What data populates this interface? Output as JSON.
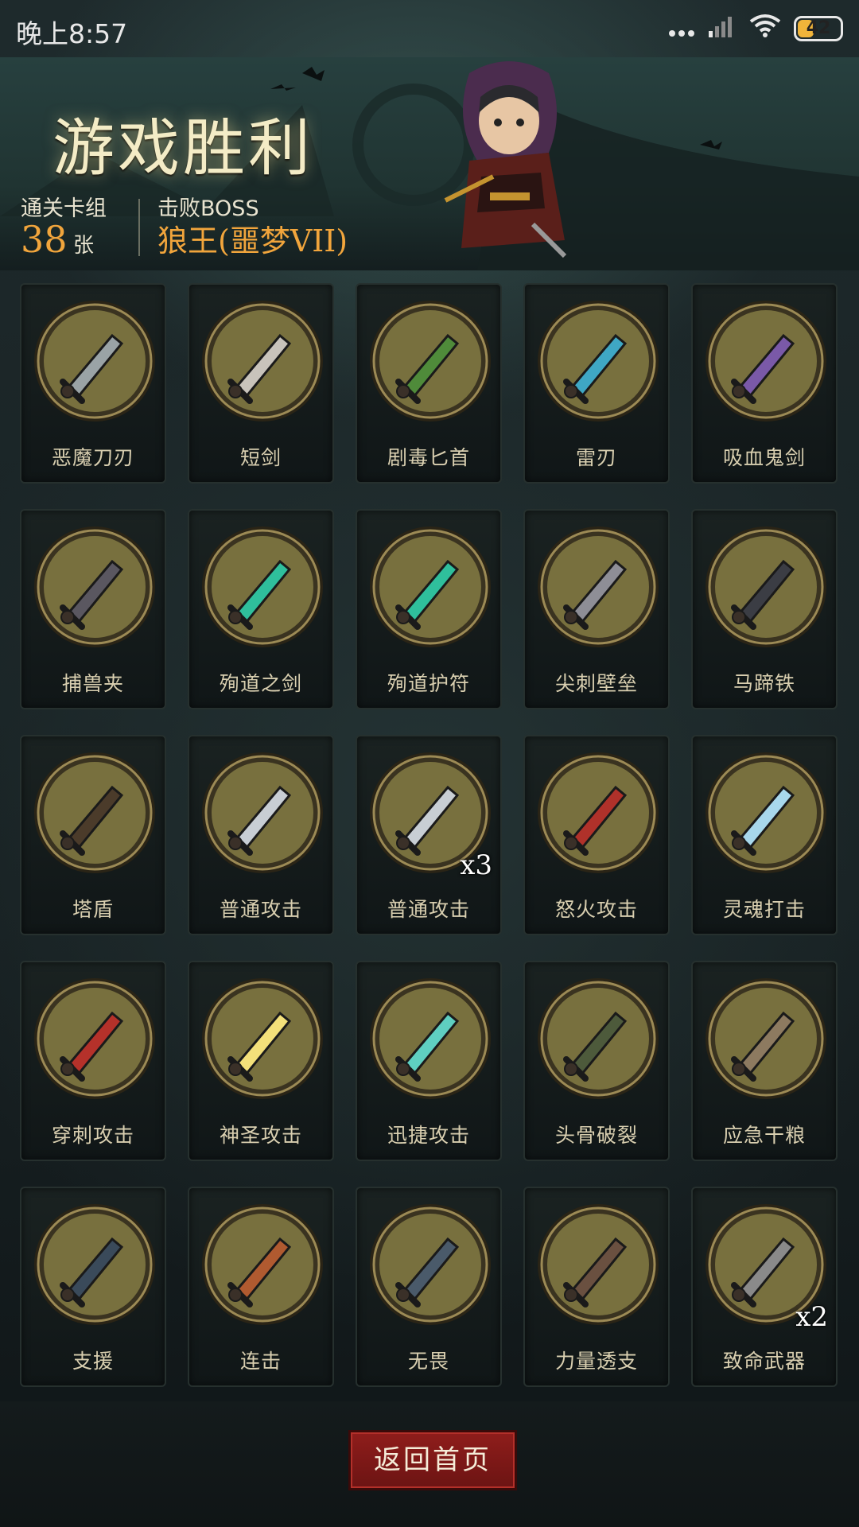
{
  "status": {
    "time": "晚上8:57",
    "battery": "42",
    "battery_level": 0.42
  },
  "header": {
    "title": "游戏胜利",
    "deck_label": "通关卡组",
    "deck_count": "38",
    "deck_unit": "张",
    "boss_label": "击败BOSS",
    "boss_name": "狼王(噩梦VII)"
  },
  "cards": [
    {
      "name": "恶魔刀刃",
      "icon": "demon-blade-icon",
      "count": ""
    },
    {
      "name": "短剑",
      "icon": "short-sword-icon",
      "count": ""
    },
    {
      "name": "剧毒匕首",
      "icon": "poison-dagger-icon",
      "count": ""
    },
    {
      "name": "雷刃",
      "icon": "thunder-blade-icon",
      "count": ""
    },
    {
      "name": "吸血鬼剑",
      "icon": "vampire-sword-icon",
      "count": ""
    },
    {
      "name": "捕兽夹",
      "icon": "bear-trap-icon",
      "count": ""
    },
    {
      "name": "殉道之剑",
      "icon": "martyr-sword-icon",
      "count": ""
    },
    {
      "name": "殉道护符",
      "icon": "martyr-amulet-icon",
      "count": ""
    },
    {
      "name": "尖刺壁垒",
      "icon": "spike-wall-icon",
      "count": ""
    },
    {
      "name": "马蹄铁",
      "icon": "horseshoe-icon",
      "count": ""
    },
    {
      "name": "塔盾",
      "icon": "tower-shield-icon",
      "count": ""
    },
    {
      "name": "普通攻击",
      "icon": "basic-attack-icon",
      "count": ""
    },
    {
      "name": "普通攻击",
      "icon": "basic-attack-icon",
      "count": "x3"
    },
    {
      "name": "怒火攻击",
      "icon": "fury-attack-icon",
      "count": ""
    },
    {
      "name": "灵魂打击",
      "icon": "soul-strike-icon",
      "count": ""
    },
    {
      "name": "穿刺攻击",
      "icon": "pierce-attack-icon",
      "count": ""
    },
    {
      "name": "神圣攻击",
      "icon": "holy-attack-icon",
      "count": ""
    },
    {
      "name": "迅捷攻击",
      "icon": "swift-attack-icon",
      "count": ""
    },
    {
      "name": "头骨破裂",
      "icon": "skull-crack-icon",
      "count": ""
    },
    {
      "name": "应急干粮",
      "icon": "ration-icon",
      "count": ""
    },
    {
      "name": "支援",
      "icon": "support-icon",
      "count": ""
    },
    {
      "name": "连击",
      "icon": "combo-icon",
      "count": ""
    },
    {
      "name": "无畏",
      "icon": "fearless-icon",
      "count": ""
    },
    {
      "name": "力量透支",
      "icon": "overexert-icon",
      "count": ""
    },
    {
      "name": "致命武器",
      "icon": "deadly-weapon-icon",
      "count": "x2"
    }
  ],
  "footer": {
    "home_label": "返回首页"
  },
  "colors": {
    "accent_gold": "#f1a53c",
    "button_red": "#8f1d1b",
    "card_circle": "#78703e"
  }
}
